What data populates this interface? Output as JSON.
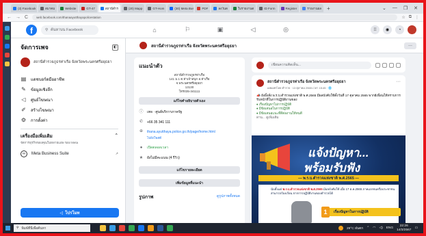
{
  "browser": {
    "tabs": [
      {
        "label": "(3) Facebook",
        "color": "#1877f2",
        "active": false
      },
      {
        "label": "สมาคม",
        "color": "#5f6368",
        "active": false
      },
      {
        "label": "Website",
        "color": "#188038",
        "active": false
      },
      {
        "label": "GT-47",
        "color": "#c5221f",
        "active": false
      },
      {
        "label": "สถานีตำร",
        "color": "#1877f2",
        "active": true
      },
      {
        "label": "(20) Mapp",
        "color": "#5f6368",
        "active": false
      },
      {
        "label": "GT-Hom",
        "color": "#5f6368",
        "active": false
      },
      {
        "label": "(30) Meta Bus",
        "color": "#0866ff",
        "active": false
      },
      {
        "label": "PDF",
        "color": "#d93025",
        "active": false
      },
      {
        "label": "ลงวันด",
        "color": "#1877f2",
        "active": false
      },
      {
        "label": "ใบรายงานต",
        "color": "#188038",
        "active": false
      },
      {
        "label": "ID Form",
        "color": "#5f6368",
        "active": false
      },
      {
        "label": "Register",
        "color": "#673ab7",
        "active": false
      },
      {
        "label": "รายงานผล",
        "color": "#4285f4",
        "active": false
      }
    ],
    "new_tab": "+",
    "window_controls": [
      "⌄",
      "—",
      "❐",
      "✕"
    ],
    "url": "web.facebook.com/thanaayutthayapolicestation",
    "nav_icons": [
      "←",
      "→",
      "C"
    ]
  },
  "facebook": {
    "search_placeholder": "ค้นหาบน Facebook",
    "nav_icons": [
      "home-icon",
      "flag-icon",
      "video-icon",
      "megaphone-icon",
      "bell-icon"
    ],
    "right_icons": [
      "menu-grid-icon",
      "messenger-icon",
      "notifications-icon",
      "avatar"
    ]
  },
  "manage": {
    "title": "จัดการเพจ",
    "page_name": "สถานีตำรวจภูธรท่าเรือ จังหวัดพระนครศรีอยุธยา",
    "menu": [
      {
        "icon": "▤",
        "label": "แดชบอร์ดมืออาชีพ",
        "name": "professional-dashboard"
      },
      {
        "icon": "✎",
        "label": "ข้อมูลเชิงลึก",
        "name": "insights"
      },
      {
        "icon": "◁",
        "label": "ศูนย์โฆษณา",
        "name": "ad-center"
      },
      {
        "icon": "✐",
        "label": "สร้างโฆษณา",
        "name": "create-ads"
      },
      {
        "icon": "⚙",
        "label": "การตั้งค่า",
        "name": "settings"
      }
    ],
    "tools_title": "เครื่องมือเพิ่มเติม",
    "tools_sub": "จัดการธุรกิจของคุณในหลายแอพ ของ Meta",
    "meta_label": "Meta Business Suite",
    "promote_label": "โปรโมท"
  },
  "page_header": {
    "name": "สถานีตำรวจภูธรท่าเรือ จังหวัดพระนครศรีอยุธยา",
    "more": "···"
  },
  "intro": {
    "title": "แนะนำตัว",
    "address_lines": [
      "สถานีตำรวจภูธรท่าเรือ",
      "141 ม.1 ต.ท่าเจ้าสนุก อ.ท่าเรือ",
      "จ.พระนครศรีอยุธยา",
      "13130",
      "โทร035-341111"
    ],
    "edit_bio": "แก้ไขคำอธิบายตัวเอง",
    "rows": [
      {
        "icon": "ⓘ",
        "text": "เพจ · ศูนย์บริการภาครัฐ",
        "kind": "plain"
      },
      {
        "icon": "✆",
        "text": "+66 35 341 111",
        "kind": "plain"
      },
      {
        "icon": "⊕",
        "text": "thana.ayutthaya.police.go.th/page/home.html",
        "kind": "link"
      },
      {
        "icon": "●",
        "text": "เปิดตลอดเวลา",
        "kind": "green"
      },
      {
        "icon": "★",
        "text": "ยังไม่มีคะแนน (4 รีวิว)",
        "kind": "plain"
      }
    ],
    "follow_prompt": "ไปยังโพสต์",
    "edit_details": "แก้ไขรายละเอียด",
    "add_featured": "เพิ่มข้อมูลที่แนะนำ",
    "photos_title": "รูปภาพ",
    "photos_link": "ดูรูปภาพทั้งหมด"
  },
  "composer": {
    "placeholder": "เขียนความคิดเห็น..."
  },
  "post": {
    "author": "สถานีตำรวจภูธรท่าเรือ จังหวัดพระนครศรีอยุธยา",
    "meta": "เผยแพร่โดย ตำรวจ · 13 ตุลาคม 2565 เวลา 15:45 · 🌐",
    "text_intro": "📣 ยังยั้งสั่ง พ.ร.บ.ตำรวจแห่งชาติ พ.ศ.2565 มีผลบังคับใช้ตั้งวันที่ 17 ตุลาคม 2565 พากย์เพื่อนให้ทราบการรับหน้าที่ในการปฏิบัติงานของ",
    "bullets": [
      "♦ เรื่องปัญหาไม่การปฏิบัติ",
      "♦ มีข้อเสนอในการปฏิบัติ",
      "♦ มีข้อเสนอแนะที่ดีต่องานให้ทนดี"
    ],
    "more": "ดาน... ดูเพิ่มเติม",
    "poster": {
      "headline1": "แจ้งปัญหา...",
      "headline2": "พร้อมรับฟัง",
      "band": "— พ.ร.บ.ตำรวจแห่งชาติ พ.ศ.2565 —",
      "body_pre": "นับตั้งแต่ ",
      "body_hl": "พ.ร.บ.ตำรวจแห่งชาติ พ.ศ.2565",
      "body_post": " มีผลบังคับใช้ เมื่อ 17 ต.ค.2565 ภาคเอกชนหรือประชาชนสามารถร้องเรียน จากการปฏิบัติงานของตำรวจได้",
      "chip_num": "1",
      "chip_label": "เรื่องปัญหาในการปฏิบัติ"
    }
  },
  "taskbar": {
    "search_placeholder": "พิมพ์ที่นี่เพื่อค้นหา",
    "apps": [
      "#f5c542",
      "#3a9de6",
      "#e8453c",
      "#34a853",
      "#1877f2",
      "#f29b1a",
      "#2b5797",
      "#34a853"
    ],
    "weather": "29°C ฝนตก",
    "lang": "ENG",
    "time": "22:26",
    "date": "14/3/2567"
  }
}
